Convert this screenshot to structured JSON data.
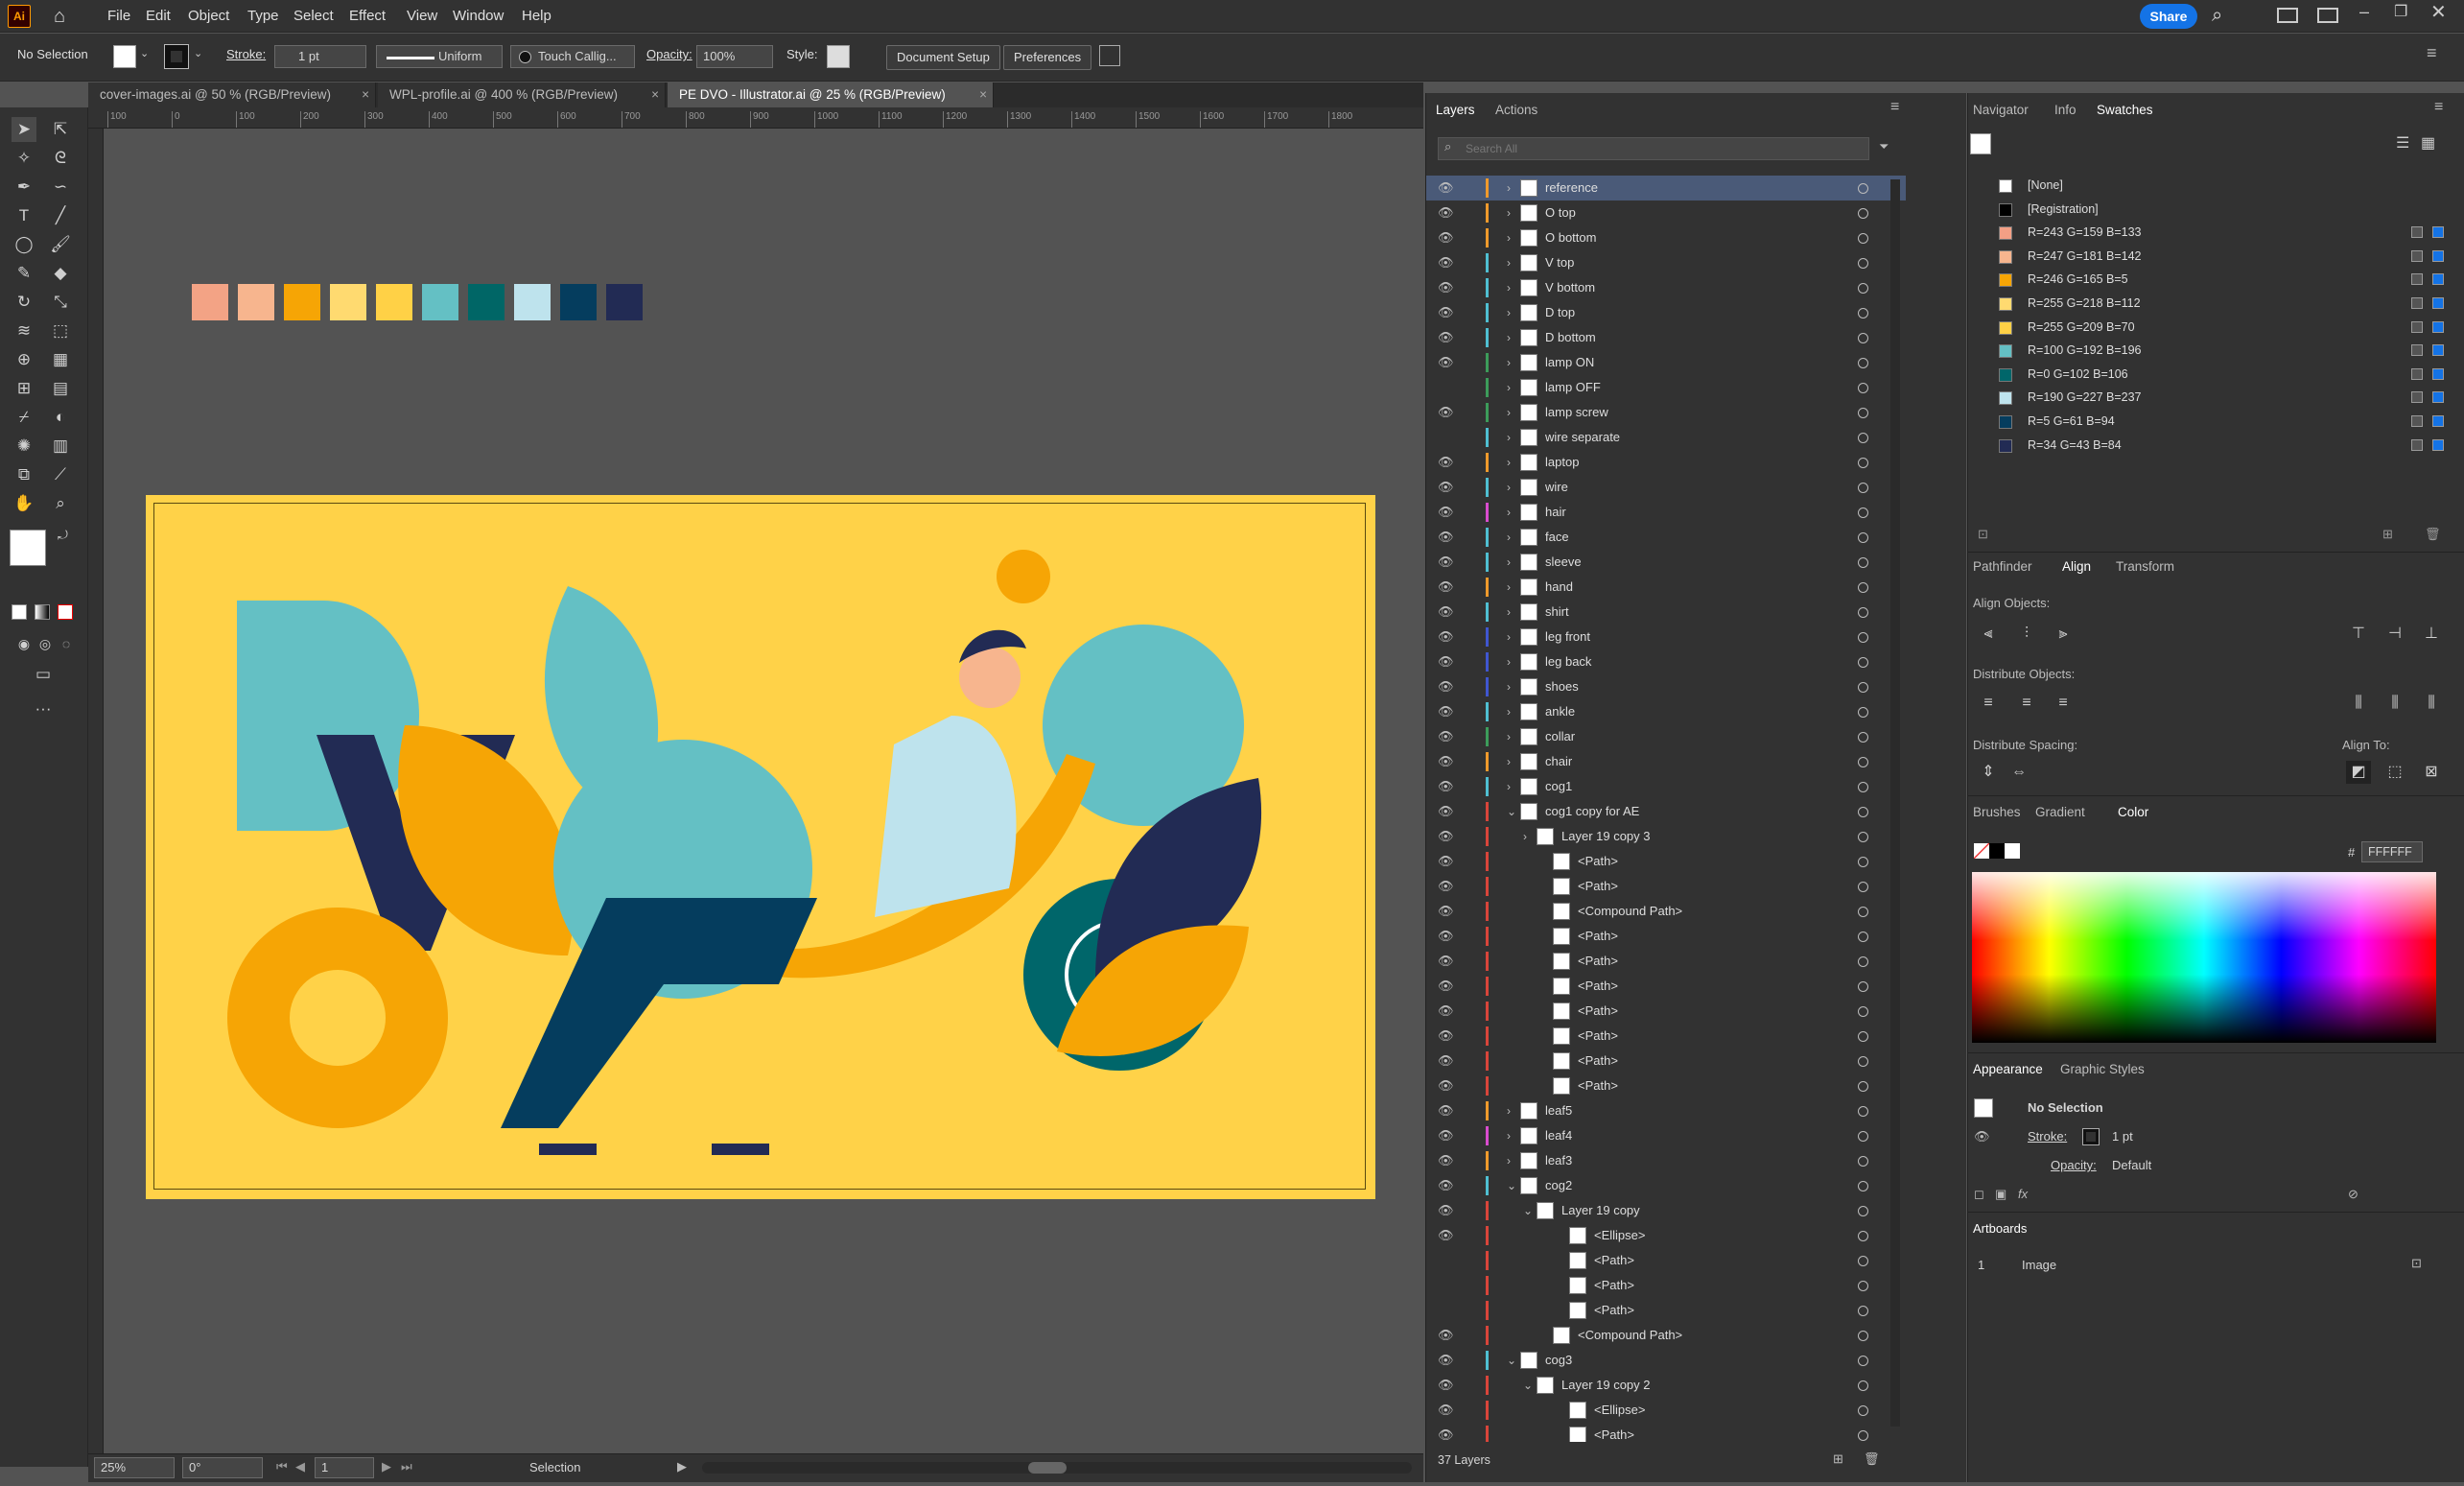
{
  "app": {
    "logo": "Ai",
    "share_label": "Share"
  },
  "menu": [
    "File",
    "Edit",
    "Object",
    "Type",
    "Select",
    "Effect",
    "View",
    "Window",
    "Help"
  ],
  "control": {
    "selection": "No Selection",
    "stroke_label": "Stroke:",
    "stroke_value": "1 pt",
    "profile": "Uniform",
    "brush": "Touch Callig...",
    "opacity_label": "Opacity:",
    "opacity_value": "100%",
    "style_label": "Style:",
    "document_setup": "Document Setup",
    "preferences": "Preferences"
  },
  "tabs": [
    {
      "label": "cover-images.ai @ 50 % (RGB/Preview)",
      "close": "×"
    },
    {
      "label": "WPL-profile.ai @ 400 % (RGB/Preview)",
      "close": "×"
    },
    {
      "label": "PE DVO - Illustrator.ai @ 25 % (RGB/Preview)",
      "close": "×"
    }
  ],
  "ruler_ticks": [
    "100",
    "0",
    "100",
    "200",
    "300",
    "400",
    "500",
    "600",
    "700",
    "800",
    "900",
    "1000",
    "1100",
    "1200",
    "1300",
    "1400",
    "1500",
    "1600",
    "1700",
    "1800"
  ],
  "palette": [
    "#f3a385",
    "#f7b58e",
    "#f6a505",
    "#ffda70",
    "#ffd146",
    "#64c0c4",
    "#006666",
    "#bee3ed",
    "#053d5e",
    "#222b54"
  ],
  "status": {
    "zoom": "25%",
    "rotation": "0°",
    "artboard": "1",
    "tool": "Selection"
  },
  "layers_panel": {
    "tabs": [
      "Layers",
      "Actions"
    ],
    "search_placeholder": "Search All",
    "footer": "37 Layers",
    "rows": [
      {
        "name": "reference",
        "indent": 0,
        "eye": true,
        "color": "#f09a2b",
        "chev": "›",
        "sel": true
      },
      {
        "name": "O top",
        "indent": 0,
        "eye": true,
        "color": "#f09a2b",
        "chev": "›"
      },
      {
        "name": "O bottom",
        "indent": 0,
        "eye": true,
        "color": "#f09a2b",
        "chev": "›"
      },
      {
        "name": "V top",
        "indent": 0,
        "eye": true,
        "color": "#4fbfd2",
        "chev": "›"
      },
      {
        "name": "V bottom",
        "indent": 0,
        "eye": true,
        "color": "#4fbfd2",
        "chev": "›"
      },
      {
        "name": "D top",
        "indent": 0,
        "eye": true,
        "color": "#4fbfd2",
        "chev": "›"
      },
      {
        "name": "D bottom",
        "indent": 0,
        "eye": true,
        "color": "#4fbfd2",
        "chev": "›"
      },
      {
        "name": "lamp ON",
        "indent": 0,
        "eye": true,
        "color": "#3c9c5a",
        "chev": "›"
      },
      {
        "name": "lamp OFF",
        "indent": 0,
        "eye": false,
        "color": "#3c9c5a",
        "chev": "›"
      },
      {
        "name": "lamp screw",
        "indent": 0,
        "eye": true,
        "color": "#3c9c5a",
        "chev": "›"
      },
      {
        "name": "wire separate",
        "indent": 0,
        "eye": false,
        "color": "#4fbfd2",
        "chev": "›"
      },
      {
        "name": "laptop",
        "indent": 0,
        "eye": true,
        "color": "#f09a2b",
        "chev": "›"
      },
      {
        "name": "wire",
        "indent": 0,
        "eye": true,
        "color": "#4fbfd2",
        "chev": "›"
      },
      {
        "name": "hair",
        "indent": 0,
        "eye": true,
        "color": "#d94ccf",
        "chev": "›"
      },
      {
        "name": "face",
        "indent": 0,
        "eye": true,
        "color": "#4fbfd2",
        "chev": "›"
      },
      {
        "name": "sleeve",
        "indent": 0,
        "eye": true,
        "color": "#4fbfd2",
        "chev": "›"
      },
      {
        "name": "hand",
        "indent": 0,
        "eye": true,
        "color": "#f09a2b",
        "chev": "›"
      },
      {
        "name": "shirt",
        "indent": 0,
        "eye": true,
        "color": "#4fbfd2",
        "chev": "›"
      },
      {
        "name": "leg front",
        "indent": 0,
        "eye": true,
        "color": "#3f56d0",
        "chev": "›"
      },
      {
        "name": "leg back",
        "indent": 0,
        "eye": true,
        "color": "#3f56d0",
        "chev": "›"
      },
      {
        "name": "shoes",
        "indent": 0,
        "eye": true,
        "color": "#3f56d0",
        "chev": "›"
      },
      {
        "name": "ankle",
        "indent": 0,
        "eye": true,
        "color": "#4fbfd2",
        "chev": "›"
      },
      {
        "name": "collar",
        "indent": 0,
        "eye": true,
        "color": "#3c9c5a",
        "chev": "›"
      },
      {
        "name": "chair",
        "indent": 0,
        "eye": true,
        "color": "#f09a2b",
        "chev": "›"
      },
      {
        "name": "cog1",
        "indent": 0,
        "eye": true,
        "color": "#4fbfd2",
        "chev": "›"
      },
      {
        "name": "cog1 copy for AE",
        "indent": 0,
        "eye": true,
        "color": "#d9453a",
        "chev": "⌄"
      },
      {
        "name": "Layer 19 copy 3",
        "indent": 1,
        "eye": true,
        "color": "#d9453a",
        "chev": "›"
      },
      {
        "name": "<Path>",
        "indent": 2,
        "eye": true,
        "color": "#d9453a",
        "chev": ""
      },
      {
        "name": "<Path>",
        "indent": 2,
        "eye": true,
        "color": "#d9453a",
        "chev": ""
      },
      {
        "name": "<Compound Path>",
        "indent": 2,
        "eye": true,
        "color": "#d9453a",
        "chev": ""
      },
      {
        "name": "<Path>",
        "indent": 2,
        "eye": true,
        "color": "#d9453a",
        "chev": ""
      },
      {
        "name": "<Path>",
        "indent": 2,
        "eye": true,
        "color": "#d9453a",
        "chev": ""
      },
      {
        "name": "<Path>",
        "indent": 2,
        "eye": true,
        "color": "#d9453a",
        "chev": ""
      },
      {
        "name": "<Path>",
        "indent": 2,
        "eye": true,
        "color": "#d9453a",
        "chev": ""
      },
      {
        "name": "<Path>",
        "indent": 2,
        "eye": true,
        "color": "#d9453a",
        "chev": ""
      },
      {
        "name": "<Path>",
        "indent": 2,
        "eye": true,
        "color": "#d9453a",
        "chev": ""
      },
      {
        "name": "<Path>",
        "indent": 2,
        "eye": true,
        "color": "#d9453a",
        "chev": ""
      },
      {
        "name": "leaf5",
        "indent": 0,
        "eye": true,
        "color": "#f09a2b",
        "chev": "›"
      },
      {
        "name": "leaf4",
        "indent": 0,
        "eye": true,
        "color": "#d94ccf",
        "chev": "›"
      },
      {
        "name": "leaf3",
        "indent": 0,
        "eye": true,
        "color": "#f09a2b",
        "chev": "›"
      },
      {
        "name": "cog2",
        "indent": 0,
        "eye": true,
        "color": "#4fbfd2",
        "chev": "⌄"
      },
      {
        "name": "Layer 19 copy",
        "indent": 1,
        "eye": true,
        "color": "#d9453a",
        "chev": "⌄"
      },
      {
        "name": "<Ellipse>",
        "indent": 3,
        "eye": true,
        "color": "#d9453a",
        "chev": ""
      },
      {
        "name": "<Path>",
        "indent": 3,
        "eye": false,
        "color": "#d9453a",
        "chev": ""
      },
      {
        "name": "<Path>",
        "indent": 3,
        "eye": false,
        "color": "#d9453a",
        "chev": ""
      },
      {
        "name": "<Path>",
        "indent": 3,
        "eye": false,
        "color": "#d9453a",
        "chev": ""
      },
      {
        "name": "<Compound Path>",
        "indent": 2,
        "eye": true,
        "color": "#d9453a",
        "chev": ""
      },
      {
        "name": "cog3",
        "indent": 0,
        "eye": true,
        "color": "#4fbfd2",
        "chev": "⌄"
      },
      {
        "name": "Layer 19 copy 2",
        "indent": 1,
        "eye": true,
        "color": "#d9453a",
        "chev": "⌄"
      },
      {
        "name": "<Ellipse>",
        "indent": 3,
        "eye": true,
        "color": "#d9453a",
        "chev": ""
      },
      {
        "name": "<Path>",
        "indent": 3,
        "eye": true,
        "color": "#d9453a",
        "chev": ""
      }
    ]
  },
  "swatches_panel": {
    "tabs": [
      "Navigator",
      "Info",
      "Swatches"
    ],
    "items": [
      {
        "name": "[None]",
        "color": "#ffffff"
      },
      {
        "name": "[Registration]",
        "color": "#000000"
      },
      {
        "name": "R=243 G=159 B=133",
        "color": "#f39f85"
      },
      {
        "name": "R=247 G=181 B=142",
        "color": "#f7b58e"
      },
      {
        "name": "R=246 G=165 B=5",
        "color": "#f6a505"
      },
      {
        "name": "R=255 G=218 B=112",
        "color": "#ffda70"
      },
      {
        "name": "R=255 G=209 B=70",
        "color": "#ffd146"
      },
      {
        "name": "R=100 G=192 B=196",
        "color": "#64c0c4"
      },
      {
        "name": "R=0 G=102 B=106",
        "color": "#00666a"
      },
      {
        "name": "R=190 G=227 B=237",
        "color": "#bee3ed"
      },
      {
        "name": "R=5 G=61 B=94",
        "color": "#053d5e"
      },
      {
        "name": "R=34 G=43 B=84",
        "color": "#222b54"
      }
    ]
  },
  "align_panel": {
    "tabs": [
      "Pathfinder",
      "Align",
      "Transform"
    ],
    "align_objects": "Align Objects:",
    "distribute_objects": "Distribute Objects:",
    "distribute_spacing": "Distribute Spacing:",
    "align_to": "Align To:"
  },
  "color_panel": {
    "tabs": [
      "Brushes",
      "Gradient",
      "Color"
    ],
    "hex_label": "#",
    "hex": "FFFFFF"
  },
  "appearance_panel": {
    "tabs": [
      "Appearance",
      "Graphic Styles"
    ],
    "selection": "No Selection",
    "stroke_label": "Stroke:",
    "stroke_value": "1 pt",
    "opacity_label": "Opacity:",
    "opacity_value": "Default"
  },
  "artboards_panel": {
    "title": "Artboards",
    "number": "1",
    "name": "Image"
  }
}
